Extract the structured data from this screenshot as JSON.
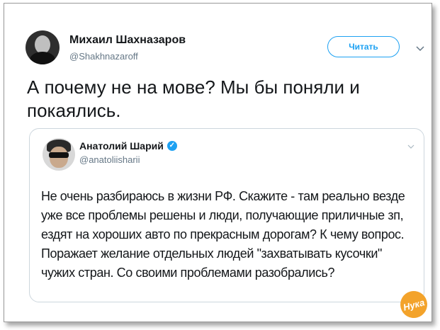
{
  "tweet": {
    "author_name": "Михаил Шахназаров",
    "author_handle": "@Shakhnazaroff",
    "follow_label": "Читать",
    "text": "А почему не на мове? Мы бы поняли и покаялись."
  },
  "quoted": {
    "author_name": "Анатолий Шарий",
    "author_handle": "@anatoliisharii",
    "verified": true,
    "text": "Не очень разбираюсь в жизни РФ. Скажите - там реально везде уже все проблемы решены и люди, получающие приличные зп, ездят на хороших авто по прекрасным дорогам? К чему вопрос. Поражает желание отдельных людей \"захватывать кусочки\" чужих стран. Со своими проблемами разобрались?"
  },
  "watermark": {
    "text": "Нука"
  },
  "colors": {
    "accent": "#1da1f2",
    "secondary_text": "#657786",
    "primary_text": "#14171a",
    "watermark": "#f3a32b"
  }
}
